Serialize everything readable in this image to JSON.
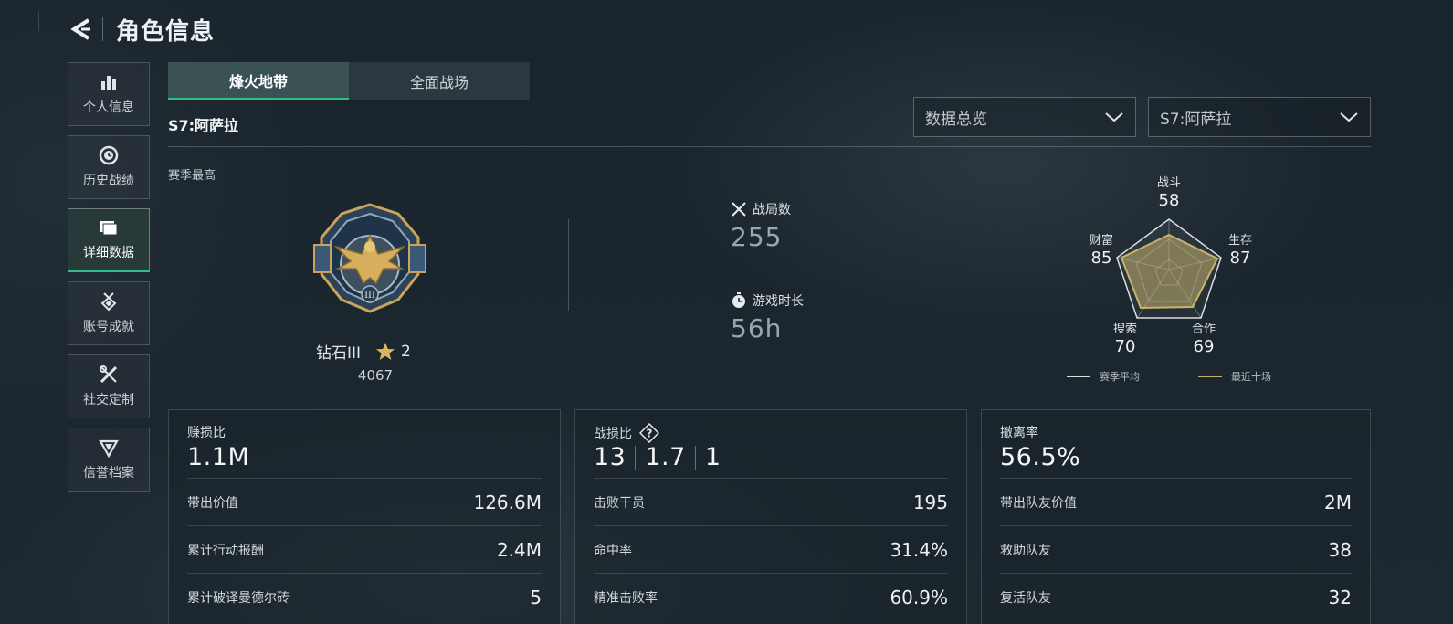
{
  "header": {
    "title": "角色信息"
  },
  "sidebar": {
    "items": [
      {
        "label": "个人信息",
        "icon": "bar-chart-icon"
      },
      {
        "label": "历史战绩",
        "icon": "history-clock-icon"
      },
      {
        "label": "详细数据",
        "icon": "folder-icon",
        "active": true
      },
      {
        "label": "账号成就",
        "icon": "medal-icon"
      },
      {
        "label": "社交定制",
        "icon": "tools-icon"
      },
      {
        "label": "信誉档案",
        "icon": "shield-icon"
      }
    ]
  },
  "tabs": [
    {
      "label": "烽火地带",
      "active": true
    },
    {
      "label": "全面战场",
      "active": false
    }
  ],
  "season_title": "S7:阿萨拉",
  "dropdowns": {
    "view": {
      "value": "数据总览"
    },
    "season": {
      "value": "S7:阿萨拉"
    }
  },
  "rank": {
    "section_label": "赛季最高",
    "name": "钻石III",
    "stars": "2",
    "points": "4067"
  },
  "stats": {
    "matches": {
      "label": "战局数",
      "value": "255"
    },
    "playtime": {
      "label": "游戏时长",
      "value": "56h"
    }
  },
  "radar": {
    "axes": [
      {
        "name": "战斗",
        "value": "58"
      },
      {
        "name": "生存",
        "value": "87"
      },
      {
        "name": "合作",
        "value": "69"
      },
      {
        "name": "搜索",
        "value": "70"
      },
      {
        "name": "财富",
        "value": "85"
      }
    ],
    "legend": {
      "season_avg": "赛季平均",
      "recent_ten": "最近十场"
    },
    "colors": {
      "season_avg": "#d9dee1",
      "recent_ten": "#c9b36a"
    }
  },
  "cards": {
    "profit": {
      "label": "赚损比",
      "value": "1.1M",
      "rows": [
        {
          "label": "带出价值",
          "value": "126.6M"
        },
        {
          "label": "累计行动报酬",
          "value": "2.4M"
        },
        {
          "label": "累计破译曼德尔砖",
          "value": "5"
        }
      ]
    },
    "kd": {
      "label": "战损比",
      "kills": "13",
      "ratio": "1.7",
      "deaths": "1",
      "rows": [
        {
          "label": "击败干员",
          "value": "195"
        },
        {
          "label": "命中率",
          "value": "31.4%"
        },
        {
          "label": "精准击败率",
          "value": "60.9%"
        }
      ]
    },
    "extract": {
      "label": "撤离率",
      "value": "56.5%",
      "rows": [
        {
          "label": "带出队友价值",
          "value": "2M"
        },
        {
          "label": "救助队友",
          "value": "38"
        },
        {
          "label": "复活队友",
          "value": "32"
        }
      ]
    }
  },
  "accent_color": "#2fbf86"
}
